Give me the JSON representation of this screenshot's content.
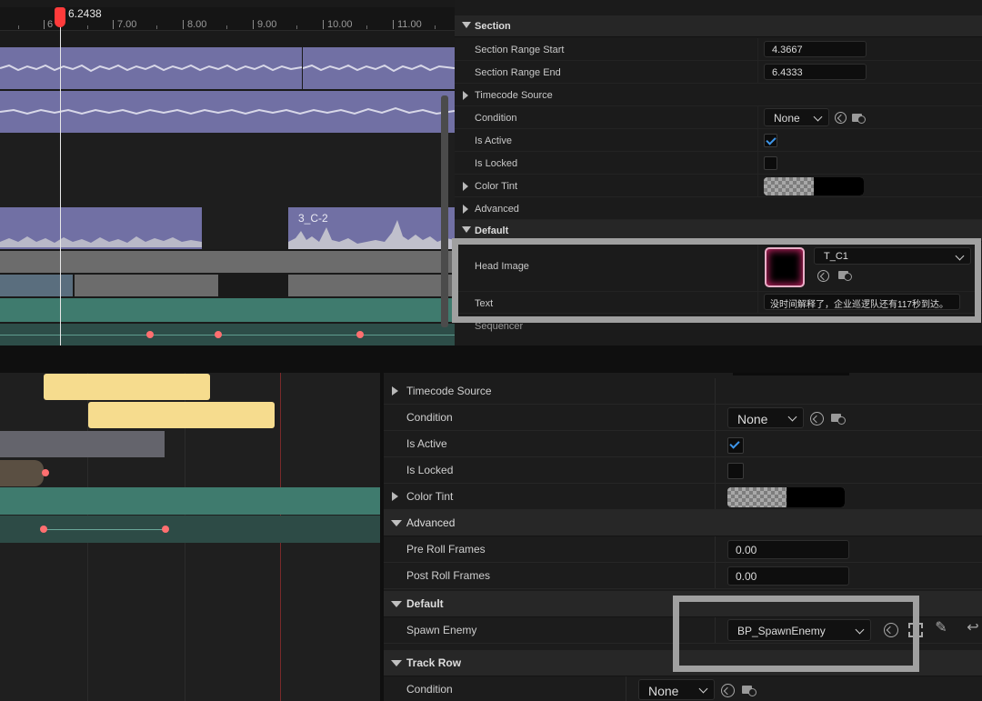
{
  "timeline": {
    "playhead": "6.2438",
    "ticks": [
      "6",
      "7.00",
      "8.00",
      "9.00",
      "10.00",
      "11.00"
    ],
    "clips": {
      "audio_label": "3_C-2"
    }
  },
  "details_top": {
    "section_header": "Section",
    "section_range_start": {
      "label": "Section Range Start",
      "value": "4.3667"
    },
    "section_range_end": {
      "label": "Section Range End",
      "value": "6.4333"
    },
    "timecode_source": "Timecode Source",
    "condition": {
      "label": "Condition",
      "value": "None"
    },
    "is_active": {
      "label": "Is Active",
      "checked": true
    },
    "is_locked": {
      "label": "Is Locked",
      "checked": false
    },
    "color_tint": "Color Tint",
    "advanced": "Advanced",
    "default_header": "Default",
    "head_image": {
      "label": "Head Image",
      "asset": "T_C1"
    },
    "text": {
      "label": "Text",
      "value": "没时间解释了，企业巡逻队还有117秒到达。"
    },
    "sequencer_header": "Sequencer"
  },
  "details_bottom": {
    "timecode_source": "Timecode Source",
    "condition": {
      "label": "Condition",
      "value": "None"
    },
    "is_active": {
      "label": "Is Active",
      "checked": true
    },
    "is_locked": {
      "label": "Is Locked",
      "checked": false
    },
    "color_tint": "Color Tint",
    "advanced": "Advanced",
    "pre_roll_frames": {
      "label": "Pre Roll Frames",
      "value": "0.00"
    },
    "post_roll_frames": {
      "label": "Post Roll Frames",
      "value": "0.00"
    },
    "default_header": "Default",
    "spawn_enemy": {
      "label": "Spawn Enemy",
      "value": "BP_SpawnEnemy"
    },
    "track_row": "Track Row",
    "track_condition": {
      "label": "Condition",
      "value": "None"
    }
  },
  "colors": {
    "audio": "#7170a4",
    "keyframe": "#ff6f70",
    "teal": "#3f7b6e",
    "clip_yellow": "#f6dc8e",
    "check": "#3e96ea"
  }
}
